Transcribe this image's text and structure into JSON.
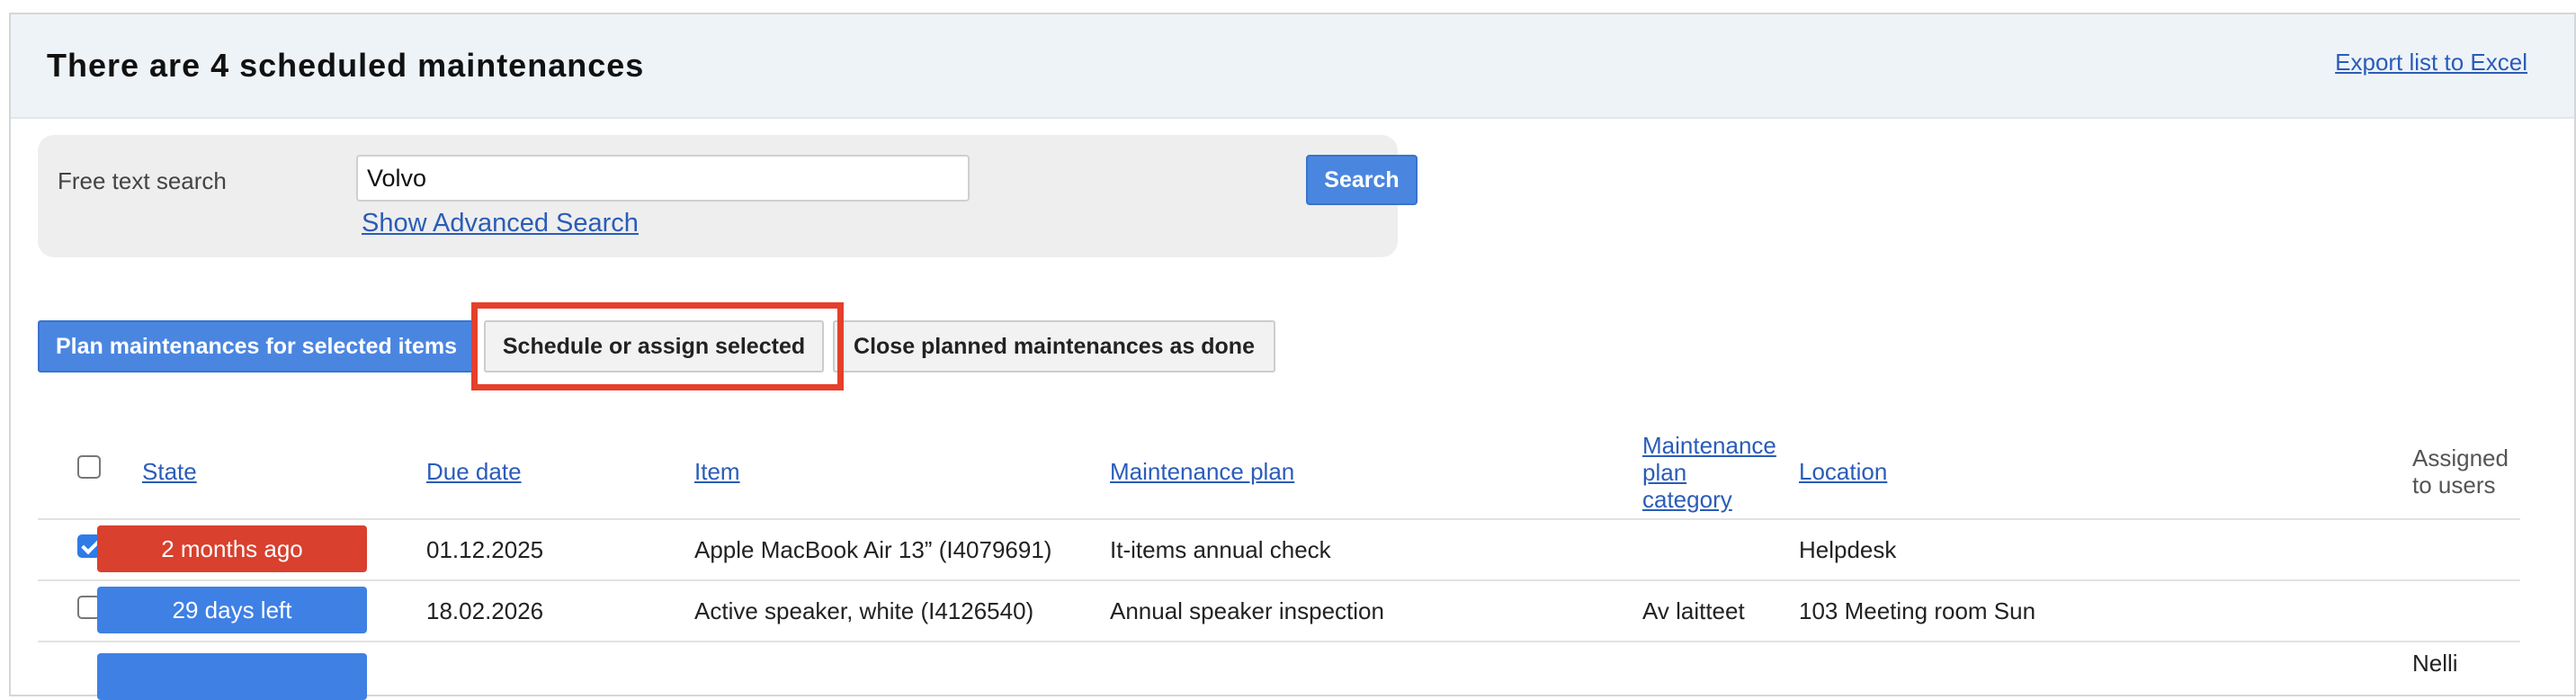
{
  "header": {
    "title": "There are 4 scheduled maintenances",
    "export_link": "Export list to Excel"
  },
  "search": {
    "label": "Free text search",
    "value": "Volvo",
    "button": "Search",
    "advanced_link": "Show Advanced Search"
  },
  "actions": {
    "plan": "Plan maintenances for selected items",
    "schedule": "Schedule or assign selected",
    "close": "Close planned maintenances as done"
  },
  "table": {
    "columns": {
      "state": "State",
      "due_date": "Due date",
      "item": "Item",
      "maintenance_plan": "Maintenance plan",
      "plan_category_line1": "Maintenance",
      "plan_category_line2": "plan",
      "plan_category_line3": "category",
      "location": "Location",
      "assigned_line1": "Assigned",
      "assigned_line2": "to users"
    },
    "rows": [
      {
        "checked": true,
        "state": "2 months ago",
        "state_color": "#d9402e",
        "due_date": "01.12.2025",
        "item": "Apple MacBook Air 13” (I4079691)",
        "maintenance_plan": "It-items annual check",
        "category": "",
        "location": "Helpdesk",
        "assigned": ""
      },
      {
        "checked": false,
        "state": "29 days left",
        "state_color": "#3f80e4",
        "due_date": "18.02.2026",
        "item": "Active speaker, white (I4126540)",
        "maintenance_plan": "Annual speaker inspection",
        "category": "Av laitteet",
        "location": "103 Meeting room Sun",
        "assigned": ""
      },
      {
        "checked": false,
        "state": "",
        "state_color": "#3f80e4",
        "due_date": "",
        "item": "",
        "maintenance_plan": "",
        "category": "",
        "location": "",
        "assigned": "Nelli"
      }
    ]
  }
}
